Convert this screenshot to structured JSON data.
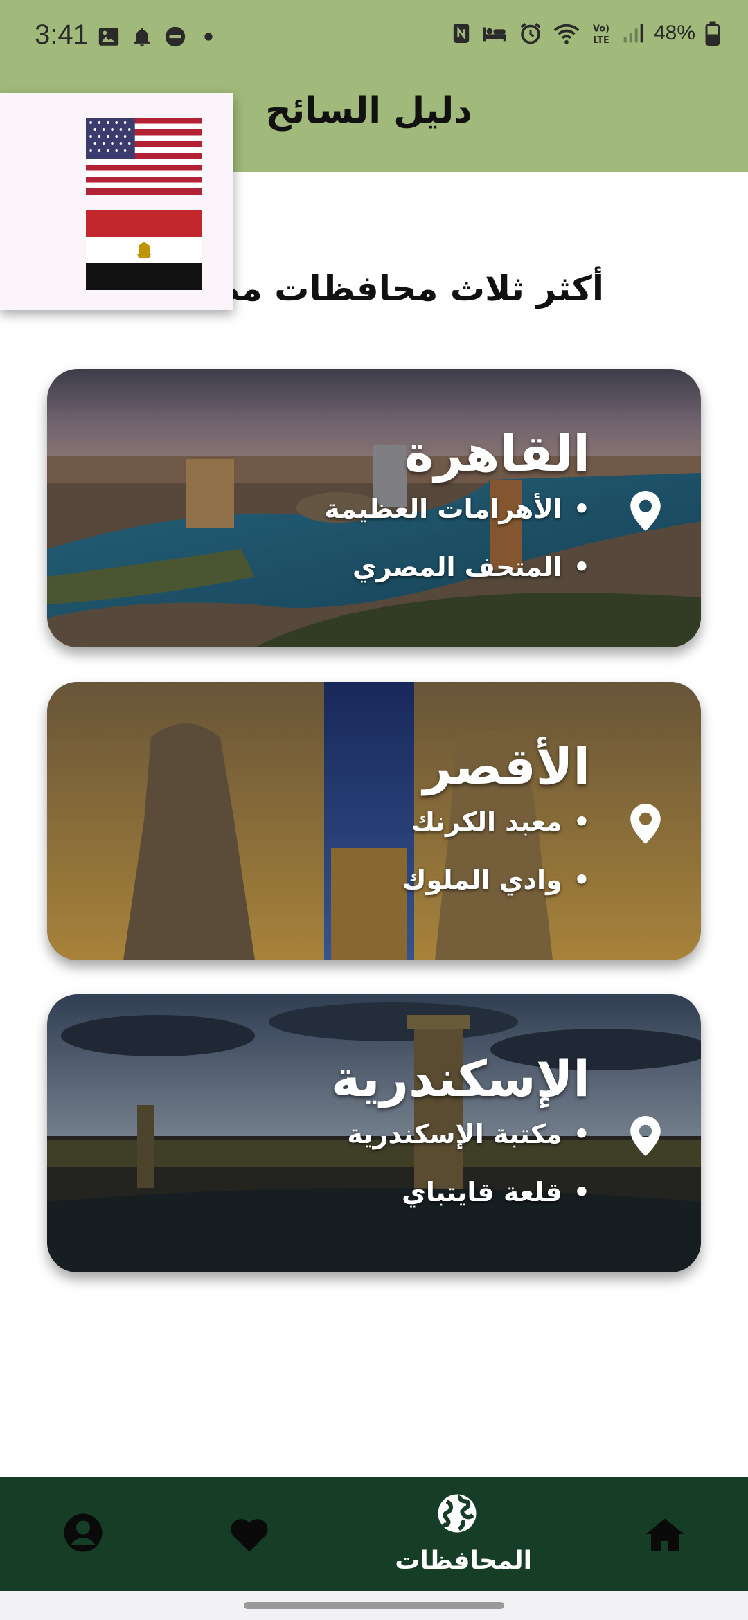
{
  "status_bar": {
    "time": "3:41",
    "battery": "48%",
    "left_icons": [
      "image-icon",
      "bell-icon",
      "do-not-disturb-icon",
      "dot-icon"
    ],
    "right_icons": [
      "nfc-icon",
      "bed-icon",
      "alarm-icon",
      "wifi-icon",
      "volte-icon",
      "signal-icon",
      "battery-icon"
    ]
  },
  "header": {
    "title": "دليل السائح"
  },
  "language_menu": {
    "options": [
      "us-flag-icon",
      "egypt-flag-icon"
    ]
  },
  "main": {
    "heading": "أكثر ثلاث محافظات مصرية زيارة",
    "cards": [
      {
        "title": "القاهرة",
        "items": [
          "الأهرامات العظيمة",
          "المتحف المصري"
        ]
      },
      {
        "title": "الأقصر",
        "items": [
          "معبد الكرنك",
          "وادي الملوك"
        ]
      },
      {
        "title": "الإسكندرية",
        "items": [
          "مكتبة الإسكندرية",
          "قلعة قايتباي"
        ]
      }
    ]
  },
  "bottom_nav": {
    "items": [
      {
        "icon": "home-icon",
        "label": ""
      },
      {
        "icon": "globe-icon",
        "label": "المحافظات"
      },
      {
        "icon": "heart-icon",
        "label": ""
      },
      {
        "icon": "account-icon",
        "label": ""
      }
    ]
  },
  "colors": {
    "header_bg": "#a1b97a",
    "nav_bg": "#163d26"
  }
}
